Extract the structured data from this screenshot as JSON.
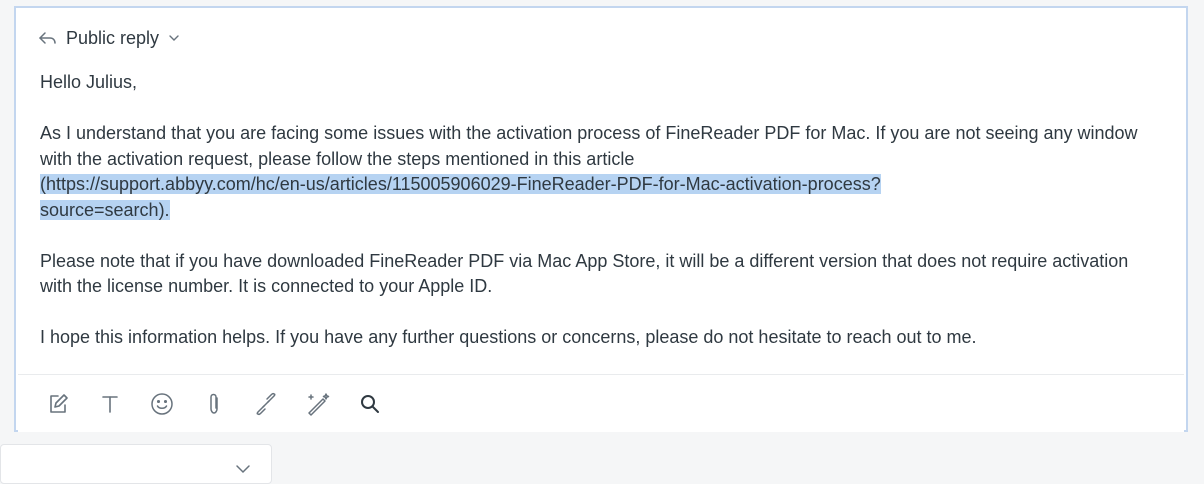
{
  "composer": {
    "channel_label": "Public reply",
    "icons": {
      "reply": "reply-arrow-icon",
      "channel_dropdown": "chevron-down-icon"
    }
  },
  "message": {
    "greeting": "Hello Julius,",
    "paragraph1_text": "As I understand that you are facing some issues with the activation process of FineReader PDF for Mac. If you are not seeing any window with the activation request, please follow the steps mentioned in this article",
    "paragraph1_link_line1": "(https://support.abbyy.com/hc/en-us/articles/115005906029-FineReader-PDF-for-Mac-activation-process?",
    "paragraph1_link_line2": "source=search).",
    "paragraph2": "Please note that if you have downloaded FineReader PDF via Mac App Store, it will be a different version that does not require activation with the license number. It is connected to your Apple ID.",
    "paragraph3": "I hope this information helps. If you have any further questions or concerns, please do not hesitate to reach out to me."
  },
  "toolbar": {
    "icons": [
      "compose-icon",
      "text-format-icon",
      "emoji-icon",
      "attachment-icon",
      "link-icon",
      "magic-wand-icon",
      "search-icon"
    ]
  },
  "colors": {
    "selection_highlight": "#b6d3f2",
    "composer_border": "#c3d6ef",
    "text": "#2f3941",
    "icon": "#68737d"
  }
}
